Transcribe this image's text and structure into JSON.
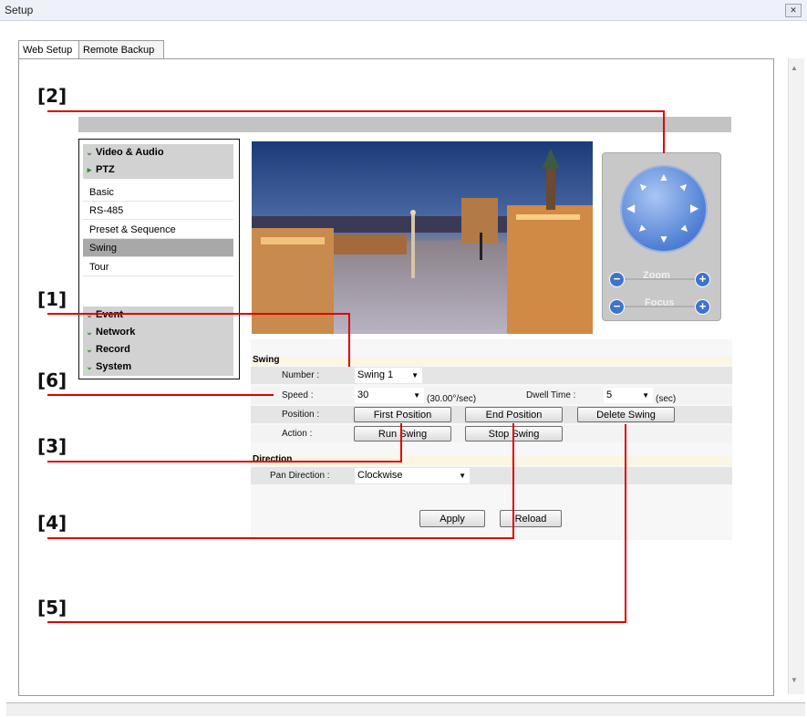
{
  "window": {
    "title": "Setup",
    "close_glyph": "✕"
  },
  "tabs": [
    {
      "label": "Web Setup",
      "active": true
    },
    {
      "label": "Remote Backup",
      "active": false
    }
  ],
  "menu": {
    "groups_top": [
      {
        "label": "Video & Audio",
        "icon": "chevron-down-icon"
      },
      {
        "label": "PTZ",
        "icon": "triangle-right-icon"
      }
    ],
    "ptz_items": [
      {
        "label": "Basic"
      },
      {
        "label": "RS-485"
      },
      {
        "label": "Preset & Sequence"
      },
      {
        "label": "Swing",
        "selected": true
      },
      {
        "label": "Tour"
      }
    ],
    "groups_bottom": [
      {
        "label": "Event"
      },
      {
        "label": "Network"
      },
      {
        "label": "Record"
      },
      {
        "label": "System"
      }
    ]
  },
  "ptz_control": {
    "zoom_label": "Zoom",
    "focus_label": "Focus",
    "minus_glyph": "−",
    "plus_glyph": "+"
  },
  "swing": {
    "section_title": "Swing",
    "number_label": "Number :",
    "number_value": "Swing 1",
    "speed_label": "Speed :",
    "speed_value": "30",
    "speed_note": "(30.00°/sec)",
    "dwell_label": "Dwell Time :",
    "dwell_value": "5",
    "dwell_unit": "(sec)",
    "position_label": "Position :",
    "first_position": "First Position",
    "end_position": "End Position",
    "delete_swing": "Delete Swing",
    "action_label": "Action :",
    "run_swing": "Run Swing",
    "stop_swing": "Stop Swing"
  },
  "direction": {
    "section_title": "Direction",
    "pan_label": "Pan Direction :",
    "pan_value": "Clockwise"
  },
  "footer_buttons": {
    "apply": "Apply",
    "reload": "Reload"
  },
  "callouts": [
    "[1]",
    "[2]",
    "[3]",
    "[4]",
    "[5]",
    "[6]"
  ],
  "colors": {
    "callout_line": "#e00000",
    "accent_blue": "#3f73cc",
    "menu_selected": "#a8a8a8"
  }
}
